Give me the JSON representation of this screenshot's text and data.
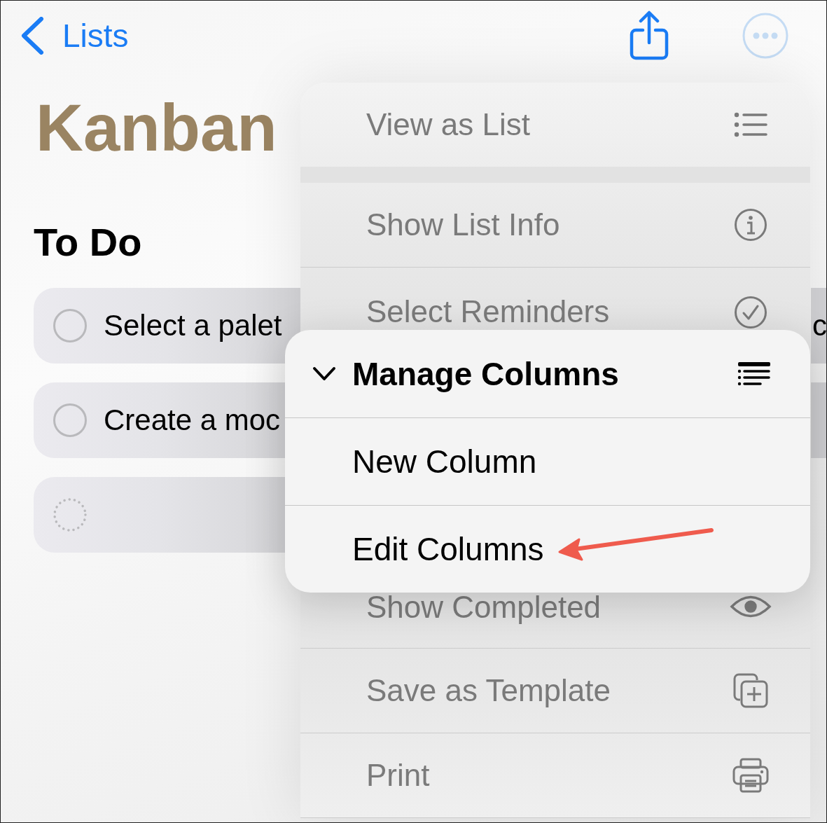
{
  "nav": {
    "back_label": "Lists"
  },
  "title": "Kanban",
  "board": {
    "columns": [
      {
        "title": "To Do",
        "cards": [
          {
            "kind": "task",
            "text": "Select a palet",
            "checked": false
          },
          {
            "kind": "task",
            "text": "Create a moc",
            "checked": false
          },
          {
            "kind": "new"
          }
        ]
      },
      {
        "cards": [
          {
            "kind": "clipped",
            "text": "c"
          },
          {
            "kind": "clipped"
          }
        ]
      }
    ]
  },
  "menu": {
    "dimmed": true,
    "sections": [
      {
        "items": [
          {
            "label": "View as List"
          }
        ]
      },
      {
        "items": [
          {
            "label": "Show List Info"
          },
          {
            "label": "Select Reminders"
          },
          {
            "label": "Show Completed"
          },
          {
            "label": "Save as Template"
          },
          {
            "label": "Print"
          }
        ]
      }
    ]
  },
  "submenu": {
    "title": "Manage Columns",
    "expanded": true,
    "items": [
      {
        "label": "New Column"
      },
      {
        "label": "Edit Columns"
      }
    ]
  }
}
